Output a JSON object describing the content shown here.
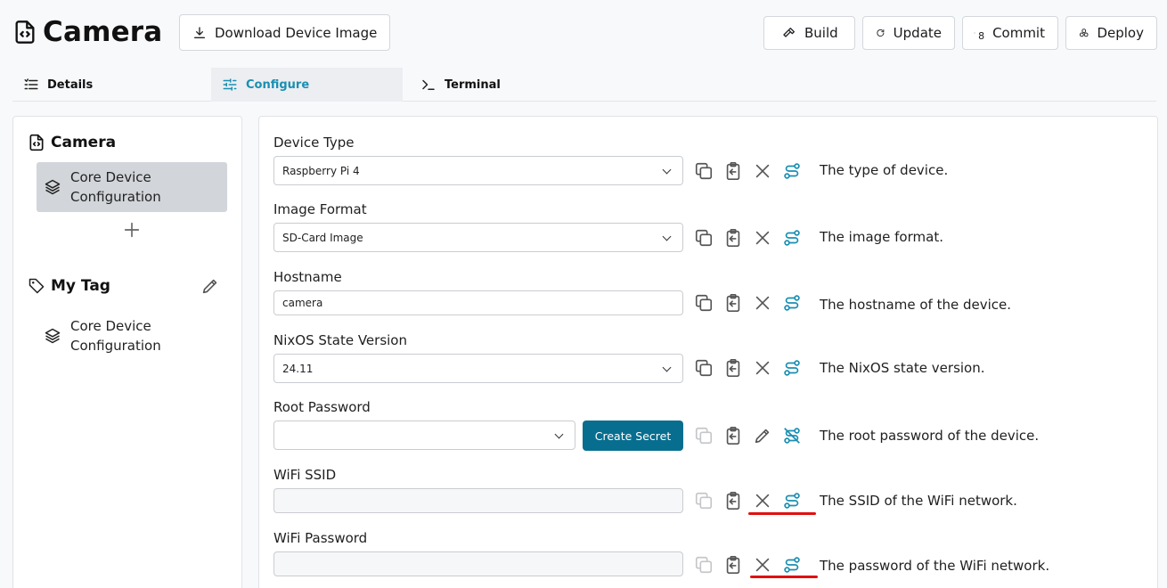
{
  "header": {
    "title": "Camera",
    "download_label": "Download Device Image",
    "build_label": "Build",
    "update_label": "Update",
    "commit_count": "8",
    "commit_label": "Commit",
    "deploy_label": "Deploy"
  },
  "tabs": [
    {
      "label": "Details"
    },
    {
      "label": "Configure"
    },
    {
      "label": "Terminal"
    }
  ],
  "sidebar": {
    "device_title": "Camera",
    "device_item": "Core Device Configuration",
    "tag_title": "My Tag",
    "tag_item": "Core Device Configuration"
  },
  "fields": {
    "device_type": {
      "label": "Device Type",
      "value": "Raspberry Pi 4",
      "desc": "The type of device."
    },
    "image_format": {
      "label": "Image Format",
      "value": "SD-Card Image",
      "desc": "The image format."
    },
    "hostname": {
      "label": "Hostname",
      "value": "camera",
      "desc": "The hostname of the device."
    },
    "state_version": {
      "label": "NixOS State Version",
      "value": "24.11",
      "desc": "The NixOS state version."
    },
    "root_password": {
      "label": "Root Password",
      "value": "",
      "button": "Create Secret",
      "desc": "The root password of the device."
    },
    "wifi_ssid": {
      "label": "WiFi SSID",
      "value": "",
      "desc": "The SSID of the WiFi network."
    },
    "wifi_password": {
      "label": "WiFi Password",
      "value": "",
      "desc": "The password of the WiFi network."
    }
  },
  "colors": {
    "accent": "#1a8fb2",
    "primary_button": "#086e8f",
    "highlight": "#e01010"
  }
}
